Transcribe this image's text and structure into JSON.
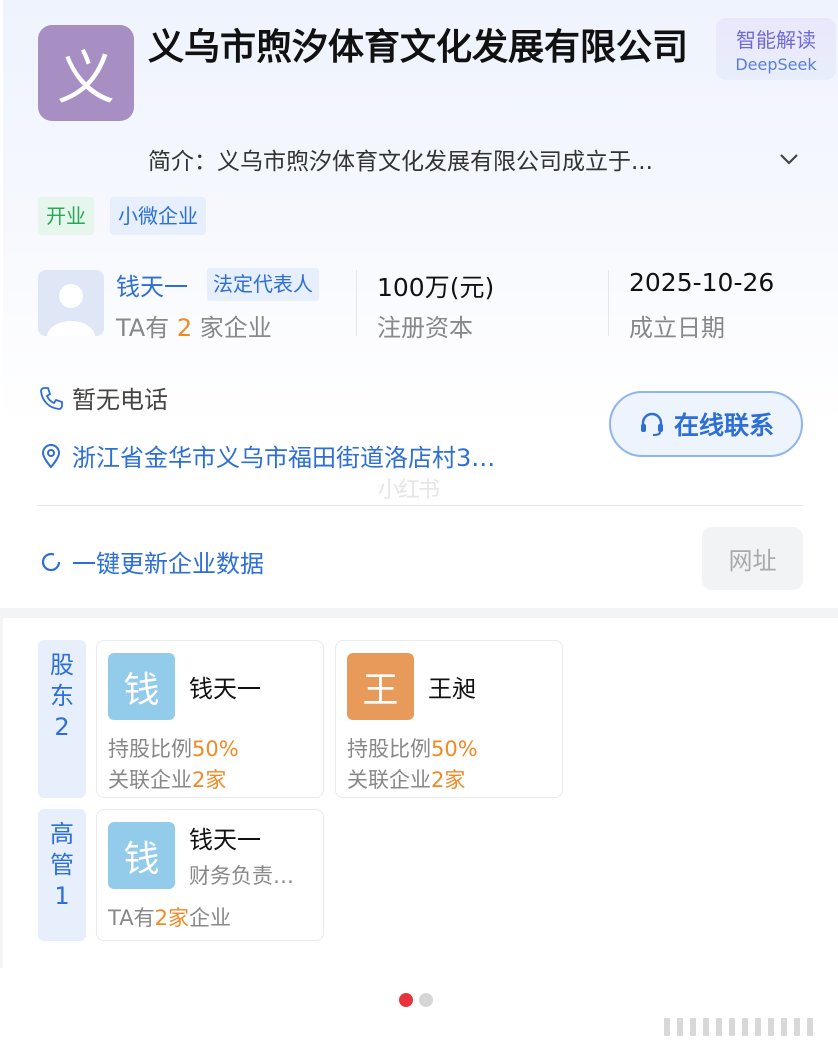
{
  "company": {
    "logo_char": "义",
    "name": "义乌市煦汐体育文化发展有限公司",
    "ai": {
      "title": "智能解读",
      "subtitle": "DeepSeek"
    },
    "intro": "简介：义乌市煦汐体育文化发展有限公司成立于...",
    "tags": [
      "开业",
      "小微企业"
    ]
  },
  "representative": {
    "name": "钱天一",
    "badge": "法定代表人",
    "sub_prefix": "TA有",
    "sub_count": "2",
    "sub_suffix": "家企业"
  },
  "stats": [
    {
      "value": "100万(元)",
      "label": "注册资本"
    },
    {
      "value": "2025-10-26",
      "label": "成立日期"
    }
  ],
  "contact": {
    "phone": "暂无电话",
    "address": "浙江省金华市义乌市福田街道洛店村3…",
    "online_button": "在线联系",
    "refresh": "一键更新企业数据",
    "website_button": "网址"
  },
  "watermark": "小红书",
  "shareholders": {
    "label": [
      "股",
      "东",
      "2"
    ],
    "items": [
      {
        "avatar_char": "钱",
        "avatar_color": "#93cbeb",
        "name": "钱天一",
        "ratio_label": "持股比例",
        "ratio_value": "50%",
        "related_label": "关联企业",
        "related_value": "2家"
      },
      {
        "avatar_char": "王",
        "avatar_color": "#e89a5a",
        "name": "王昶",
        "ratio_label": "持股比例",
        "ratio_value": "50%",
        "related_label": "关联企业",
        "related_value": "2家"
      }
    ]
  },
  "executives": {
    "label": [
      "高",
      "管",
      "1"
    ],
    "items": [
      {
        "avatar_char": "钱",
        "avatar_color": "#93cbeb",
        "name": "钱天一",
        "role": "财务负责…",
        "sub_prefix": "TA有",
        "sub_value": "2家",
        "sub_suffix": "企业"
      }
    ]
  },
  "pagination": {
    "active_color": "#e8323c",
    "inactive_color": "#d6d6d6"
  },
  "colors": {
    "accent": "#2d6fd6",
    "highlight": "#f08a24",
    "logo_bg": "#a78fc4"
  }
}
